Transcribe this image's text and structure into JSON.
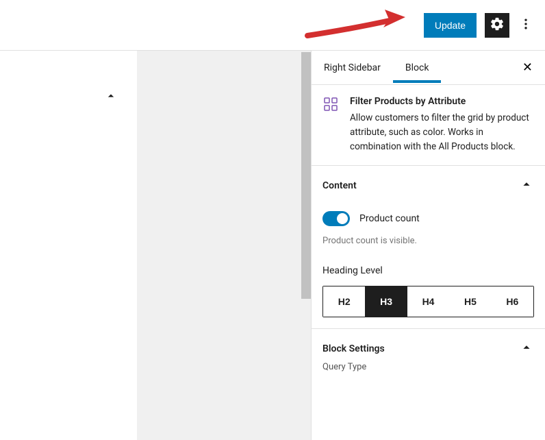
{
  "topbar": {
    "update_label": "Update"
  },
  "sidebar": {
    "tabs": {
      "right_sidebar": "Right Sidebar",
      "block": "Block"
    },
    "block": {
      "title": "Filter Products by Attribute",
      "description": "Allow customers to filter the grid by product attribute, such as color. Works in combination with the All Products block."
    },
    "content": {
      "title": "Content",
      "toggle_label": "Product count",
      "help_text": "Product count is visible.",
      "heading_label": "Heading Level",
      "headings": {
        "h2": "H2",
        "h3": "H3",
        "h4": "H4",
        "h5": "H5",
        "h6": "H6"
      },
      "selected_heading": "H3"
    },
    "block_settings": {
      "title": "Block Settings",
      "cutoff": "Query Type"
    }
  }
}
